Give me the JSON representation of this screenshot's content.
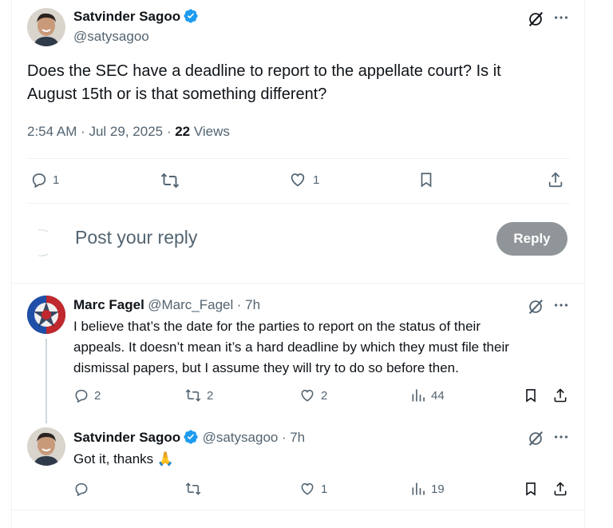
{
  "main_post": {
    "author_name": "Satvinder Sagoo",
    "author_handle": "@satysagoo",
    "text_line1": "Does the SEC have a deadline to report to the appellate court? Is it",
    "text_line2": "August 15th or is that something different?",
    "timestamp": "2:54 AM · Jul 29, 2025 · ",
    "views_count": "22",
    "views_label": "Views",
    "actions": {
      "replies": "1",
      "reposts": "",
      "likes": "1"
    }
  },
  "composer": {
    "placeholder": "Post your reply",
    "button_label": "Reply"
  },
  "replies": [
    {
      "author_name": "Marc Fagel",
      "author_handle": "@Marc_Fagel",
      "time": "· 7h",
      "text_lines": [
        "I believe that’s the date for the parties to report on the status of their",
        "appeals. It doesn’t mean it’s a hard deadline by which they must file their",
        "dismissal papers, but I assume they will try to do so before then."
      ],
      "replies": "2",
      "reposts": "2",
      "likes": "2",
      "views": "44"
    },
    {
      "author_name": "Satvinder Sagoo",
      "author_handle": "@satysagoo",
      "time": "· 7h",
      "text": "Got it, thanks 🙏",
      "replies": "",
      "reposts": "",
      "likes": "1",
      "views": "19"
    }
  ],
  "colors": {
    "verified": "#1d9bf0",
    "muted": "#536471",
    "reply_button": "#8f9598"
  }
}
